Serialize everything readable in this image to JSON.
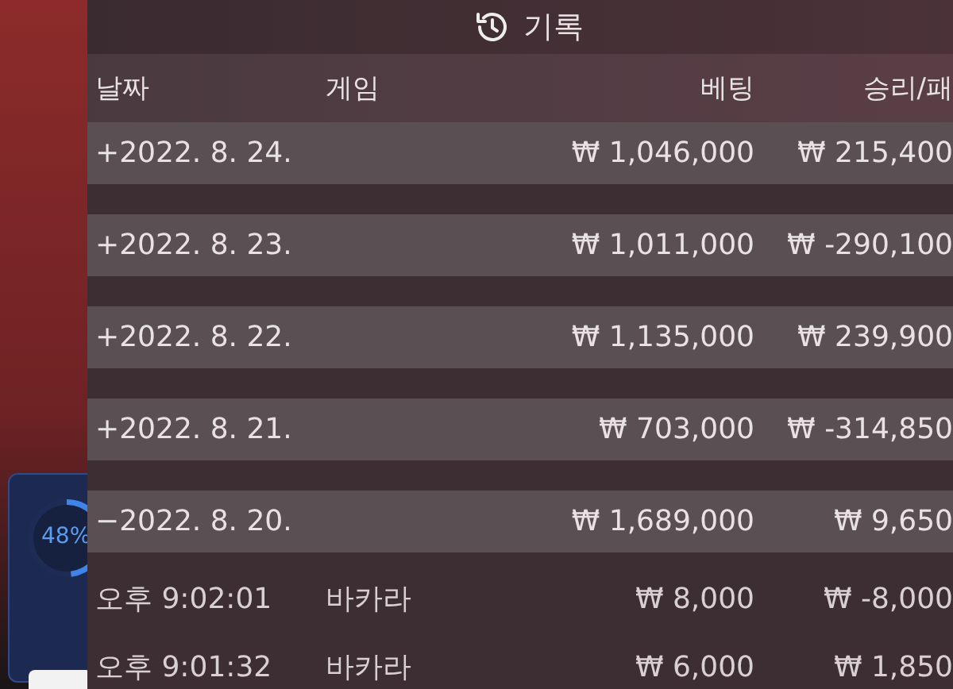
{
  "title": "기록",
  "progress": {
    "label": "48%"
  },
  "columns": [
    "날짜",
    "게임",
    "베팅",
    "승리/패"
  ],
  "days": [
    {
      "toggle": "+",
      "date": "2022. 8. 24.",
      "bet": "₩ 1,046,000",
      "result": "₩ 215,400"
    },
    {
      "toggle": "+",
      "date": "2022. 8. 23.",
      "bet": "₩ 1,011,000",
      "result": "₩ -290,100"
    },
    {
      "toggle": "+",
      "date": "2022. 8. 22.",
      "bet": "₩ 1,135,000",
      "result": "₩ 239,900"
    },
    {
      "toggle": "+",
      "date": "2022. 8. 21.",
      "bet": "₩ 703,000",
      "result": "₩ -314,850"
    },
    {
      "toggle": "−",
      "date": "2022. 8. 20.",
      "bet": "₩ 1,689,000",
      "result": "₩ 9,650"
    }
  ],
  "entries": [
    {
      "time": "오후 9:02:01",
      "game": "바카라",
      "bet": "₩ 8,000",
      "result": "₩ -8,000"
    },
    {
      "time": "오후 9:01:32",
      "game": "바카라",
      "bet": "₩ 6,000",
      "result": "₩ 1,850"
    }
  ]
}
